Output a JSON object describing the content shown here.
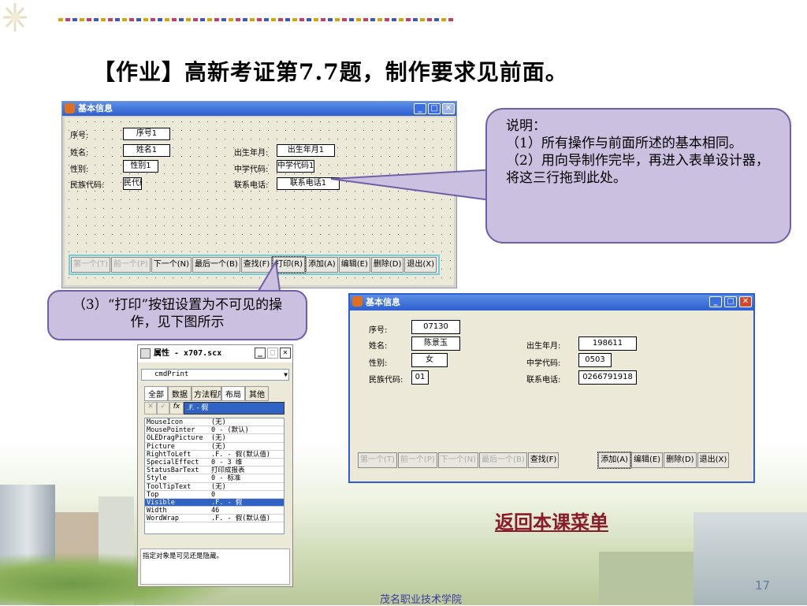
{
  "slide": {
    "title": "【作业】高新考证第7.7题，制作要求见前面。",
    "link": "返回本课菜单",
    "footer": "茂名职业技术学院",
    "page_number": "17"
  },
  "callouts": {
    "note_title": "说明：",
    "note_1": "（1）所有操作与前面所述的基本相同。",
    "note_2": "（2）用向导制作完毕，再进入表单设计器，将这三行拖到此处。",
    "note_3": "（3）“打印”按钮设置为不可见的操作，见下图所示"
  },
  "design_form": {
    "title": "基本信息",
    "labels": {
      "seq": "序号:",
      "name": "姓名:",
      "sex": "性别:",
      "ethnic": "民族代码:",
      "birth": "出生年月:",
      "school": "中学代码:",
      "phone": "联系电话:"
    },
    "fields": {
      "seq": "序号1",
      "name": "姓名1",
      "sex": "性别1",
      "ethnic": "民代码",
      "birth": "出生年月1",
      "school": "中学代码1",
      "phone": "联系电话1"
    },
    "buttons": [
      "第一个(T)",
      "前一个(P)",
      "下一个(N)",
      "最后一个(B)",
      "查找(F)",
      "打印(R)",
      "添加(A)",
      "编辑(E)",
      "删除(D)",
      "退出(X)"
    ]
  },
  "run_form": {
    "title": "基本信息",
    "labels": {
      "seq": "序号:",
      "name": "姓名:",
      "sex": "性别:",
      "ethnic": "民族代码:",
      "birth": "出生年月:",
      "school": "中学代码:",
      "phone": "联系电话:"
    },
    "fields": {
      "seq": "07130",
      "name": "陈景玉",
      "sex": "女",
      "ethnic": "01",
      "birth": "198611",
      "school": "0503",
      "phone": "0266791918"
    },
    "buttons": [
      "第一个(T)",
      "前一个(P)",
      "下一个(N)",
      "最后一个(B)",
      "查找(F)",
      "添加(A)",
      "编辑(E)",
      "删除(D)",
      "退出(X)"
    ]
  },
  "properties": {
    "title": "属性 - x707.scx",
    "object": "cmdPrint",
    "tabs": [
      "全部",
      "数据",
      "方法程序",
      "布局",
      "其他"
    ],
    "value_box": ".F. - 假",
    "rows": [
      {
        "name": "MouseIcon",
        "value": "(无)"
      },
      {
        "name": "MousePointer",
        "value": "0 - (默认)"
      },
      {
        "name": "OLEDragPicture",
        "value": "(无)"
      },
      {
        "name": "Picture",
        "value": "(无)"
      },
      {
        "name": "RightToLeft",
        "value": ".F. - 假(默认值)"
      },
      {
        "name": "SpecialEffect",
        "value": "0 - 3 维"
      },
      {
        "name": "StatusBarText",
        "value": "打印成报表"
      },
      {
        "name": "Style",
        "value": "0 - 标准"
      },
      {
        "name": "ToolTipText",
        "value": "(无)"
      },
      {
        "name": "Top",
        "value": "0"
      },
      {
        "name": "Visible",
        "value": ".F. - 假"
      },
      {
        "name": "Width",
        "value": "46"
      },
      {
        "name": "WordWrap",
        "value": ".F. - 假(默认值)"
      }
    ],
    "description": "指定对象是可见还是隐藏。"
  }
}
